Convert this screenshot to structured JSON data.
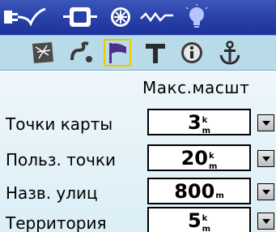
{
  "column_header": "Макс.масшт",
  "status_icons": [
    "connector-icon",
    "gps-device-icon",
    "satellite-icon",
    "signal-wave-icon",
    "backlight-bulb-icon"
  ],
  "tabs": [
    {
      "icon": "map-detail-icon",
      "selected": false
    },
    {
      "icon": "track-icon",
      "selected": false
    },
    {
      "icon": "waypoint-flag-icon",
      "selected": true
    },
    {
      "icon": "text-icon",
      "selected": false
    },
    {
      "icon": "info-icon",
      "selected": false
    },
    {
      "icon": "marine-anchor-icon",
      "selected": false
    }
  ],
  "rows": [
    {
      "label": "Точки карты",
      "value": "3",
      "unit_top": "k",
      "unit_bottom": "m"
    },
    {
      "label": "Польз. точки",
      "value": "20",
      "unit_top": "k",
      "unit_bottom": "m"
    },
    {
      "label": "Назв. улиц",
      "value": "800",
      "unit": "m"
    },
    {
      "label": "Территория",
      "value": "5",
      "unit_top": "k",
      "unit_bottom": "m"
    }
  ],
  "colors": {
    "titlebar": "#2740a8",
    "tabbar": "#b9dbe9",
    "selected_border": "#e8c800",
    "content": "#e3f2f8"
  }
}
